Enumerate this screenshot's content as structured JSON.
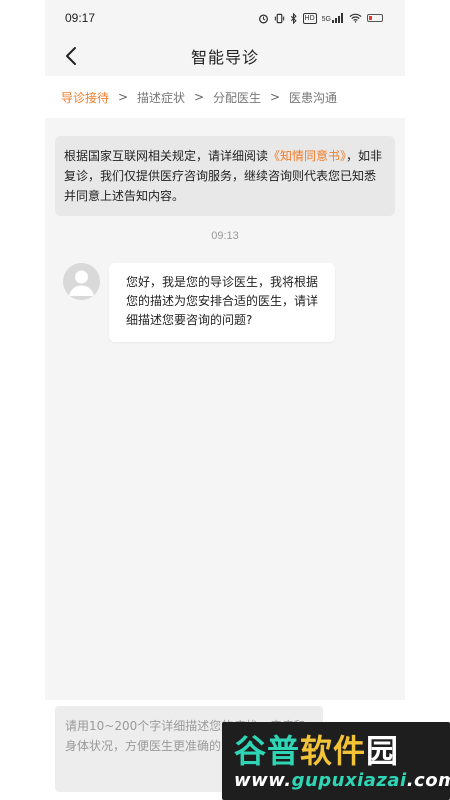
{
  "status_bar": {
    "time": "09:17",
    "icons": [
      "alarm-icon",
      "vibrate-icon",
      "bluetooth-icon",
      "hd-icon",
      "signal-5g-icon",
      "wifi-icon",
      "battery-low-icon"
    ],
    "net_label": "5G",
    "hd_label": "HD"
  },
  "nav": {
    "back_icon": "chevron-left-icon",
    "title": "智能导诊"
  },
  "steps": [
    {
      "label": "导诊接待",
      "active": true
    },
    {
      "label": "描述症状",
      "active": false
    },
    {
      "label": "分配医生",
      "active": false
    },
    {
      "label": "医患沟通",
      "active": false
    }
  ],
  "step_separator": ">",
  "notice": {
    "before": "根据国家互联网相关规定，请详细阅读",
    "link": "《知情同意书》",
    "after": "，如非复诊，我们仅提供医疗咨询服务，继续咨询则代表您已知悉并同意上述告知内容。"
  },
  "chat": {
    "time": "09:13",
    "avatar_icon": "doctor-avatar-icon",
    "message": "您好，我是您的导诊医生，我将根据您的描述为您安排合适的医生，请详细描述您要咨询的问题?"
  },
  "input": {
    "placeholder": "请用10~200个字详细描述您的症状、疾病和身体状况，方便医生更准确的为您解答。",
    "value": ""
  },
  "watermark": {
    "brand_part1": "谷普",
    "brand_part2": "软件",
    "brand_part3": "园",
    "url_part1": "www.",
    "url_part2": "gupuxiazai",
    "url_part3": ".com"
  },
  "colors": {
    "accent": "#f07c2a",
    "background": "#f5f5f5",
    "bubble": "#ffffff",
    "notice_bg": "#e8e8e8"
  }
}
